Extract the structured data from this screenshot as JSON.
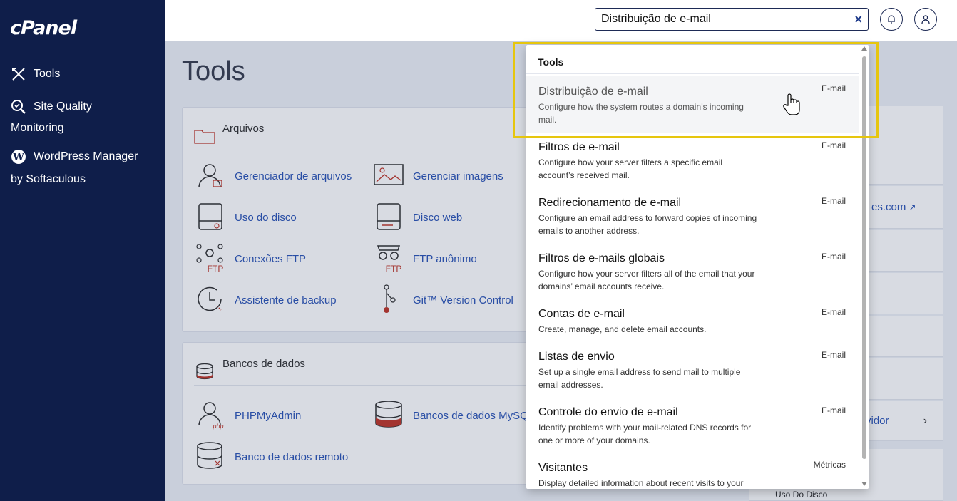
{
  "sidebar": {
    "logo": "cPanel",
    "items": [
      {
        "label": "Tools"
      },
      {
        "label": "Site Quality",
        "label2": "Monitoring"
      },
      {
        "label": "WordPress Manager",
        "label2": "by Softaculous"
      }
    ]
  },
  "topbar": {
    "search_value": "Distribuição de e-mail",
    "clear_icon": "×"
  },
  "main": {
    "title": "Tools",
    "files_section": {
      "title": "Arquivos",
      "tools": [
        {
          "label": "Gerenciador de arquivos"
        },
        {
          "label": "Gerenciar imagens"
        },
        {
          "label": "Uso do disco"
        },
        {
          "label": "Disco web"
        },
        {
          "label": "Conexões FTP"
        },
        {
          "label": "FTP anônimo"
        },
        {
          "label": "Assistente de backup"
        },
        {
          "label": "Git™ Version Control"
        }
      ]
    },
    "db_section": {
      "title": "Bancos de dados",
      "tools": [
        {
          "label": "PHPMyAdmin"
        },
        {
          "label": "Bancos de dados MySQL"
        },
        {
          "label": "Banco de dados remoto"
        }
      ]
    },
    "right_partial": {
      "link_text": "es.com",
      "text2": "vidor",
      "text3": "Uso Do Disco"
    }
  },
  "dropdown": {
    "header": "Tools",
    "items": [
      {
        "title": "Distribuição de e-mail",
        "desc": "Configure how the system routes a domain’s incoming mail.",
        "category": "E-mail"
      },
      {
        "title": "Filtros de e-mail",
        "desc": "Configure how your server filters a specific email account’s received mail.",
        "category": "E-mail"
      },
      {
        "title": "Redirecionamento de e-mail",
        "desc": "Configure an email address to forward copies of incoming emails to another address.",
        "category": "E-mail"
      },
      {
        "title": "Filtros de e-mails globais",
        "desc": "Configure how your server filters all of the email that your domains’ email accounts receive.",
        "category": "E-mail"
      },
      {
        "title": "Contas de e-mail",
        "desc": "Create, manage, and delete email accounts.",
        "category": "E-mail"
      },
      {
        "title": "Listas de envio",
        "desc": "Set up a single email address to send mail to multiple email addresses.",
        "category": "E-mail"
      },
      {
        "title": "Controle do envio de e-mail",
        "desc": "Identify problems with your mail-related DNS records for one or more of your domains.",
        "category": "E-mail"
      },
      {
        "title": "Visitantes",
        "desc": "Display detailed information about recent visits to your",
        "category": "Métricas"
      }
    ]
  },
  "colors": {
    "sidebar_bg": "#0f1e4a",
    "highlight": "#e6c60e",
    "link": "#2f57b7"
  }
}
